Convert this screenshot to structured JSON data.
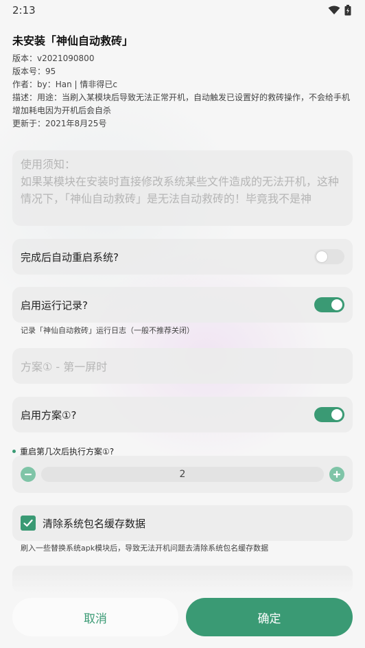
{
  "status_bar": {
    "time": "2:13",
    "icons": [
      "wifi-icon",
      "battery-icon"
    ]
  },
  "module": {
    "title": "未安装「神仙自动救砖」",
    "version": "版本：v2021090800",
    "version_code": "版本号：95",
    "author": "作者：by：Han | 情非得已c",
    "description": "描述：用途：当刷入某模块后导致无法正常开机，自动触发已设置好的救砖操作，不会给手机增加耗电因为开机后会自杀",
    "updated": "更新于：2021年8月25号"
  },
  "notice": {
    "heading": "使用须知：",
    "body": "如果某模块在安装时直接修改系统某些文件造成的无法开机，这种情况下，「神仙自动救砖」是无法自动救砖的！毕竟我不是神"
  },
  "settings": {
    "auto_reboot": {
      "label": "完成后自动重启系统?",
      "enabled": false
    },
    "run_log": {
      "label": "启用运行记录?",
      "enabled": true,
      "hint": "记录「神仙自动救砖」运行日志（一般不推荐关闭）"
    }
  },
  "plan1": {
    "section_title": "方案① - 第一屏时",
    "enable_label": "启用方案①?",
    "enabled": true,
    "question": "重启第几次后执行方案①?",
    "stepper_value": "2",
    "clear_cache": {
      "label": "清除系统包名缓存数据",
      "checked": true,
      "hint": "刷入一些替换系统apk模块后，导致无法开机问题去清除系统包名缓存数据"
    }
  },
  "actions": {
    "cancel": "取消",
    "confirm": "确定"
  },
  "colors": {
    "accent": "#3a9a74",
    "accent_light": "#7fc4a7"
  }
}
